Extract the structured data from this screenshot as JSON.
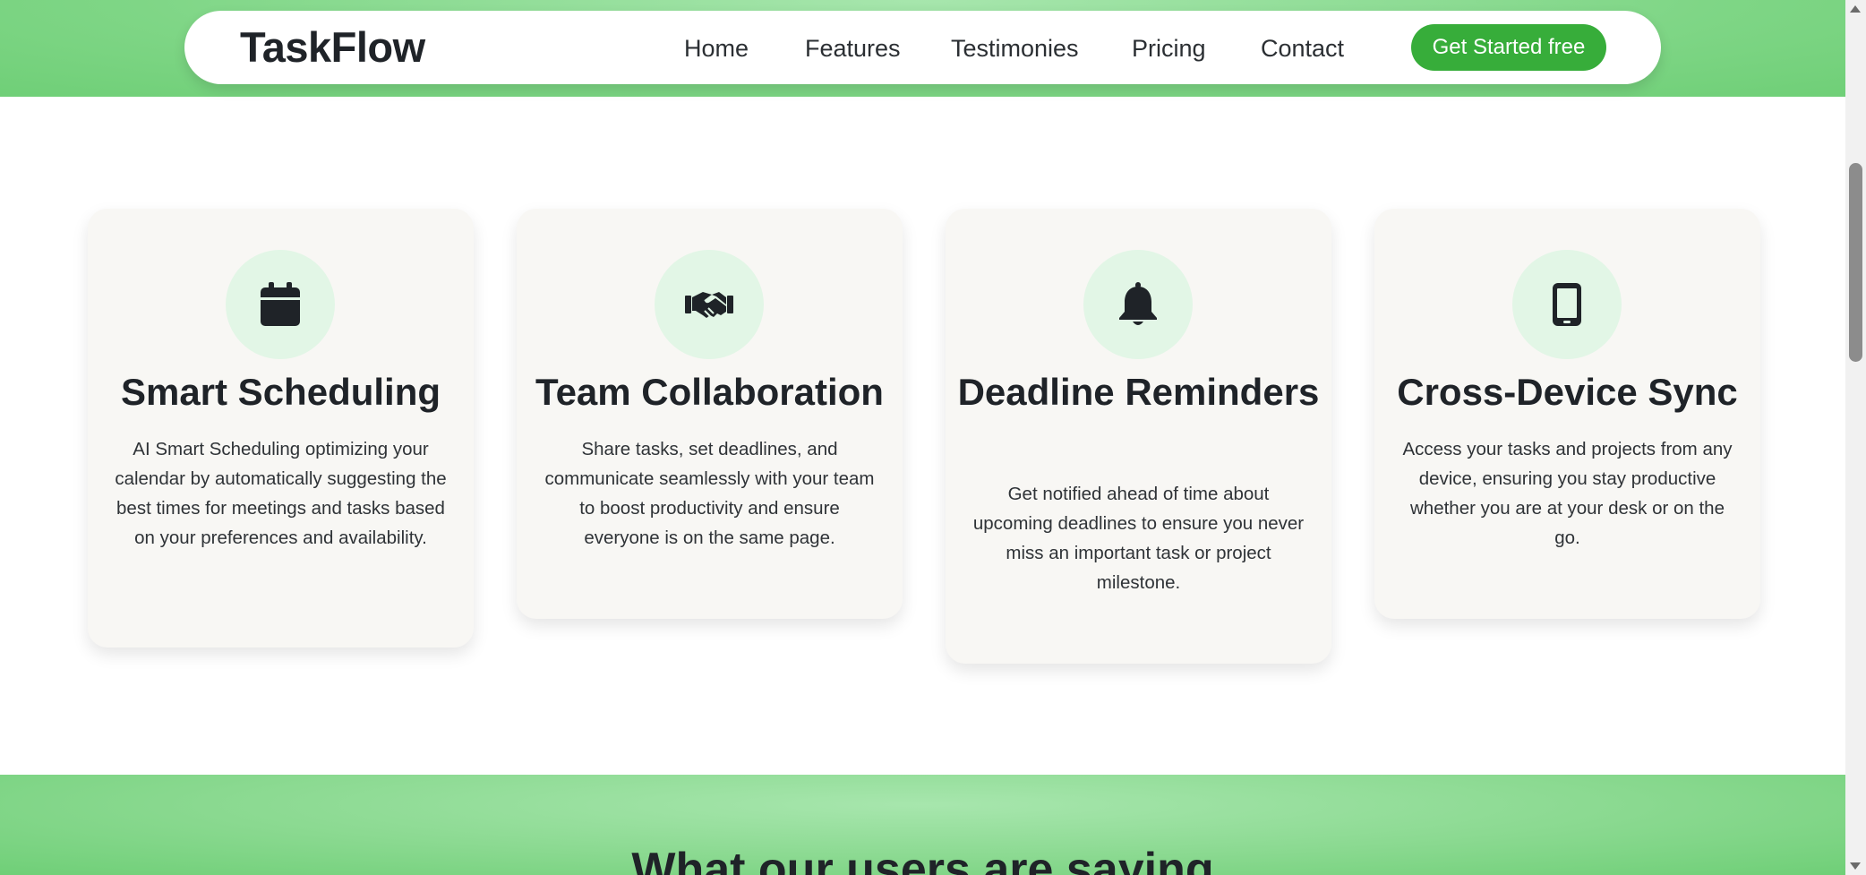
{
  "nav": {
    "logo": "TaskFlow",
    "links": [
      "Home",
      "Features",
      "Testimonies",
      "Pricing",
      "Contact"
    ],
    "cta": "Get Started free"
  },
  "features": [
    {
      "icon": "calendar-icon",
      "title": "Smart Scheduling",
      "text": "AI Smart Scheduling optimizing your calendar by automatically suggesting the best times for meetings and tasks based on your preferences and availability."
    },
    {
      "icon": "handshake-icon",
      "title": "Team Collaboration",
      "text": "Share tasks, set deadlines, and communicate seamlessly with your team to boost productivity and ensure everyone is on the same page."
    },
    {
      "icon": "bell-icon",
      "title": "Deadline Reminders",
      "text": "Get notified ahead of time about upcoming deadlines to ensure you never miss an important task or project milestone."
    },
    {
      "icon": "mobile-phone-icon",
      "title": "Cross-Device Sync",
      "text": "Access your tasks and projects from any device, ensuring you stay productive whether you are at your desk or on the go."
    }
  ],
  "testimonials": {
    "heading": "What our users are saying"
  },
  "colors": {
    "accent_green": "#37ad3a",
    "band_green": "#7fd686",
    "icon_circle": "#e2f6e6",
    "card_bg": "#f8f7f4"
  }
}
